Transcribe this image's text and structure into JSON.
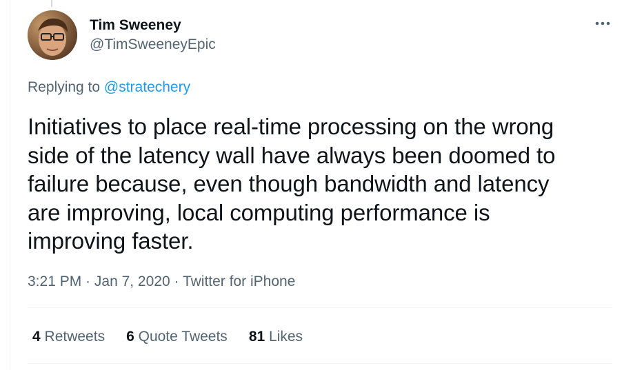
{
  "tweet": {
    "author": {
      "display_name": "Tim Sweeney",
      "handle": "@TimSweeneyEpic",
      "avatar_icon": "profile-photo"
    },
    "replying": {
      "prefix": "Replying to",
      "mention": "@stratechery"
    },
    "text_lines": [
      "Initiatives to place real-time processing on the wrong",
      "side of the latency wall have always been doomed to",
      "failure because, even though bandwidth and latency",
      "are improving, local computing performance is",
      "improving faster."
    ],
    "meta": {
      "time": "3:21 PM",
      "sep1": " · ",
      "date": "Jan 7, 2020",
      "sep2": " · ",
      "source": "Twitter for iPhone"
    },
    "stats": {
      "retweets_count": "4",
      "retweets_label": "Retweets",
      "quotes_count": "6",
      "quotes_label": "Quote Tweets",
      "likes_count": "81",
      "likes_label": "Likes"
    }
  },
  "colors": {
    "text_primary": "#0f1419",
    "text_secondary": "#536471",
    "link": "#1d9bf0",
    "divider": "#eff3f4"
  }
}
